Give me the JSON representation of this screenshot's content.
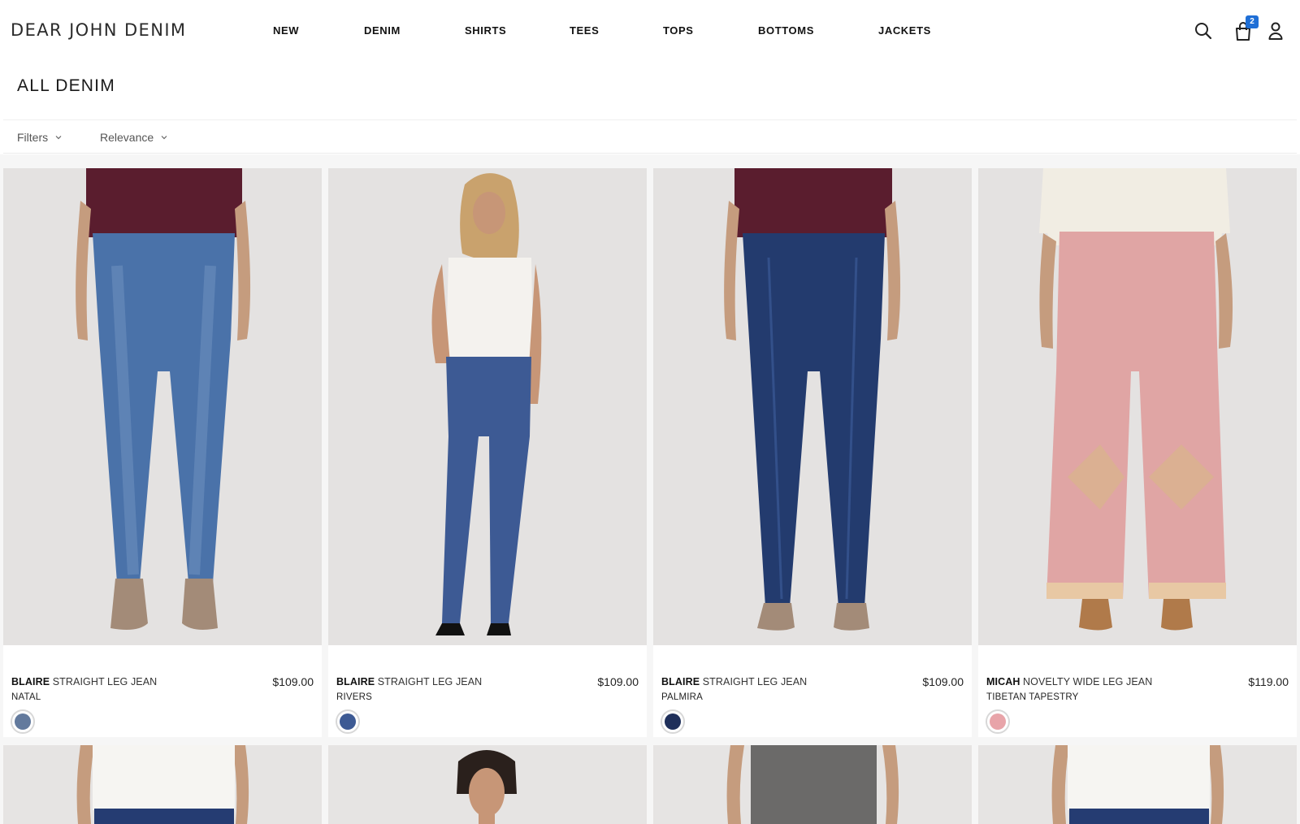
{
  "header": {
    "logo": "DEAR JOHN DENIM",
    "nav": [
      "NEW",
      "DENIM",
      "SHIRTS",
      "TEES",
      "TOPS",
      "BOTTOMS",
      "JACKETS"
    ],
    "cart_count": "2"
  },
  "page": {
    "title": "ALL DENIM",
    "filters_label": "Filters",
    "sort_label": "Relevance"
  },
  "products": [
    {
      "style": "BLAIRE",
      "type": "STRAIGHT LEG JEAN",
      "variant": "NATAL",
      "price": "$109.00",
      "swatch_color": "#637a9d"
    },
    {
      "style": "BLAIRE",
      "type": "STRAIGHT LEG JEAN",
      "variant": "RIVERS",
      "price": "$109.00",
      "swatch_color": "#3d5a94"
    },
    {
      "style": "BLAIRE",
      "type": "STRAIGHT LEG JEAN",
      "variant": "PALMIRA",
      "price": "$109.00",
      "swatch_color": "#1f2f5a"
    },
    {
      "style": "MICAH",
      "type": "NOVELTY WIDE LEG JEAN",
      "variant": "TIBETAN TAPESTRY",
      "price": "$119.00",
      "swatch_color": "#e8a4a9"
    }
  ],
  "colors": {
    "badge": "#1f6fd6",
    "denim_mid": "#4a72a9",
    "denim_dark": "#233b6e",
    "pink_jean": "#e0a5a4",
    "photo_bg": "#e4e2e1"
  }
}
